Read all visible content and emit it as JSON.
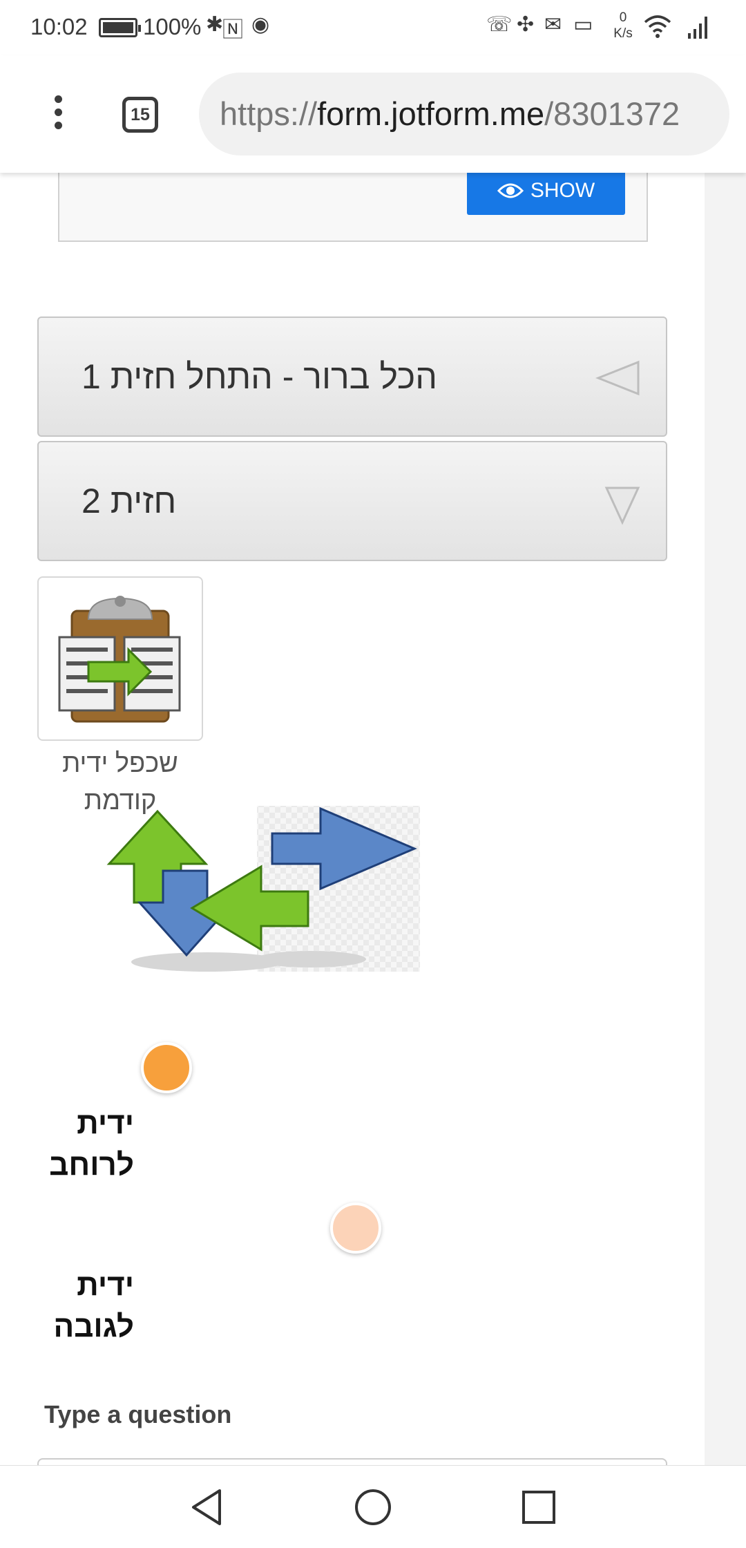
{
  "status_bar": {
    "time": "10:02",
    "battery": "100%",
    "net_speed_value": "0",
    "net_speed_unit": "K/s"
  },
  "browser": {
    "tab_count": "15",
    "url_scheme": "https://",
    "url_host": "form.jotform.me",
    "url_path": "/8301372"
  },
  "form": {
    "show_button": "SHOW",
    "collapse_1_title": "הכל ברור - התחל חזית 1",
    "collapse_2_title": "חזית 2",
    "widget_label": "שכפל ידית קודמת",
    "slider_width_label": "ידית לרוחב",
    "slider_height_label": "ידית לגובה",
    "question_label": "Type a question"
  },
  "colors": {
    "accent_blue": "#1778e6",
    "slider_orange": "#f7a03c",
    "slider_peach": "#fcd3b8"
  },
  "icons": [
    "menu-dots-icon",
    "tab-switcher-icon",
    "eye-icon",
    "collapse-left-arrow-icon",
    "collapse-down-arrow-icon",
    "clipboard-copy-icon",
    "swap-arrows-icon",
    "nav-back-icon",
    "nav-home-icon",
    "nav-recents-icon"
  ]
}
